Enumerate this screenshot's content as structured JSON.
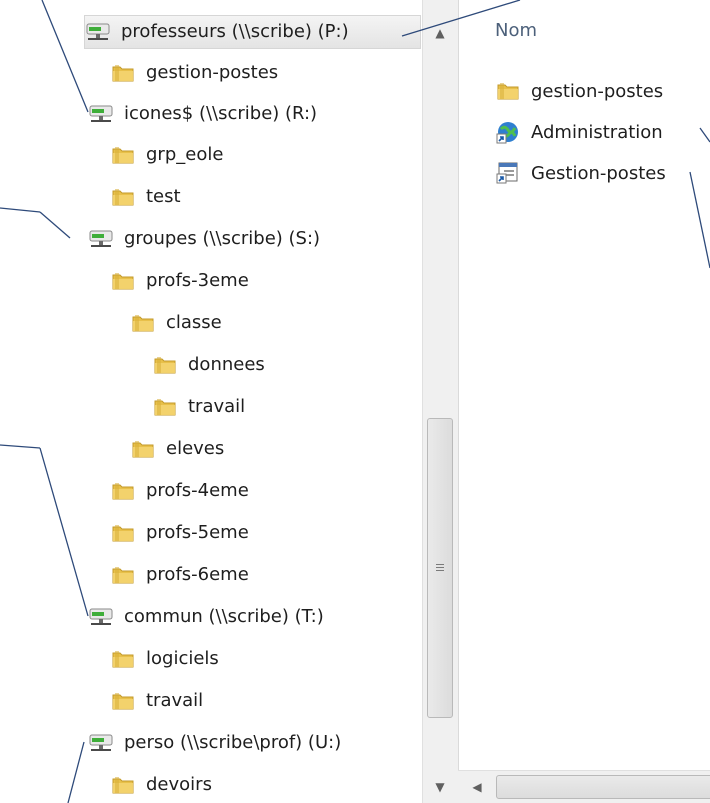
{
  "tree": {
    "items": [
      {
        "label": "professeurs (\\\\scribe) (P:)",
        "type": "drive"
      },
      {
        "label": "gestion-postes",
        "type": "folder"
      },
      {
        "label": "icones$ (\\\\scribe) (R:)",
        "type": "drive"
      },
      {
        "label": "grp_eole",
        "type": "folder"
      },
      {
        "label": "test",
        "type": "folder"
      },
      {
        "label": "groupes (\\\\scribe) (S:)",
        "type": "drive"
      },
      {
        "label": "profs-3eme",
        "type": "folder"
      },
      {
        "label": "classe",
        "type": "folder"
      },
      {
        "label": "donnees",
        "type": "folder"
      },
      {
        "label": "travail",
        "type": "folder"
      },
      {
        "label": "eleves",
        "type": "folder"
      },
      {
        "label": "profs-4eme",
        "type": "folder"
      },
      {
        "label": "profs-5eme",
        "type": "folder"
      },
      {
        "label": "profs-6eme",
        "type": "folder"
      },
      {
        "label": "commun (\\\\scribe) (T:)",
        "type": "drive"
      },
      {
        "label": "logiciels",
        "type": "folder"
      },
      {
        "label": "travail",
        "type": "folder"
      },
      {
        "label": "perso (\\\\scribe\\prof) (U:)",
        "type": "drive"
      },
      {
        "label": "devoirs",
        "type": "folder"
      }
    ]
  },
  "content": {
    "column_header": "Nom",
    "files": [
      {
        "label": "gestion-postes",
        "type": "folder"
      },
      {
        "label": "Administration",
        "type": "web-shortcut"
      },
      {
        "label": "Gestion-postes",
        "type": "app-shortcut"
      }
    ]
  },
  "icons": {
    "folder": "folder-icon",
    "drive": "network-drive-icon",
    "web-shortcut": "globe-shortcut-icon",
    "app-shortcut": "window-shortcut-icon"
  },
  "colors": {
    "callout_line": "#2e4a7a",
    "folder_body": "#e8c04a",
    "drive_green": "#3fae3a",
    "header_text": "#4c607a"
  }
}
